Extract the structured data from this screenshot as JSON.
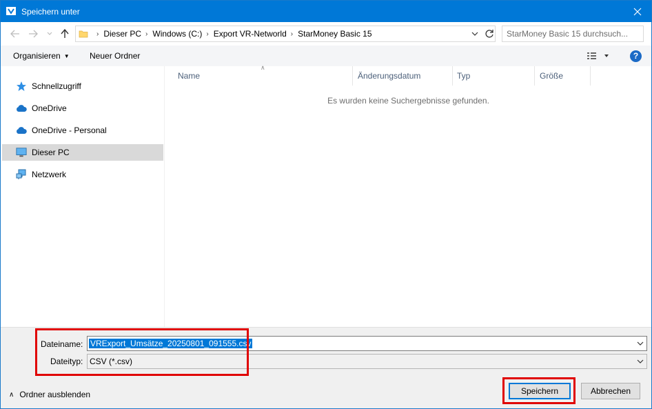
{
  "window": {
    "title": "Speichern unter",
    "close_icon": "close-icon"
  },
  "navigation": {
    "breadcrumbs": [
      "Dieser PC",
      "Windows (C:)",
      "Export VR-Networld",
      "StarMoney Basic 15"
    ],
    "search_placeholder": "StarMoney Basic 15 durchsuch..."
  },
  "toolbar": {
    "organize_label": "Organisieren",
    "new_folder_label": "Neuer Ordner"
  },
  "sidebar": {
    "items": [
      {
        "label": "Schnellzugriff",
        "icon": "star-icon"
      },
      {
        "label": "OneDrive",
        "icon": "cloud-icon"
      },
      {
        "label": "OneDrive - Personal",
        "icon": "cloud-icon"
      },
      {
        "label": "Dieser PC",
        "icon": "monitor-icon",
        "selected": true
      },
      {
        "label": "Netzwerk",
        "icon": "network-icon"
      }
    ]
  },
  "file_list": {
    "columns": [
      "Name",
      "Änderungsdatum",
      "Typ",
      "Größe"
    ],
    "empty_message": "Es wurden keine Suchergebnisse gefunden."
  },
  "save_form": {
    "filename_label": "Dateiname:",
    "filename_value": "VRExport_Umsätze_20250801_091555.csv",
    "filetype_label": "Dateityp:",
    "filetype_value": "CSV (*.csv)",
    "hide_folders_label": "Ordner ausblenden",
    "save_label": "Speichern",
    "cancel_label": "Abbrechen"
  },
  "colors": {
    "titlebar": "#0078d7",
    "highlight_box": "#e00000",
    "selection": "#0078d7"
  }
}
